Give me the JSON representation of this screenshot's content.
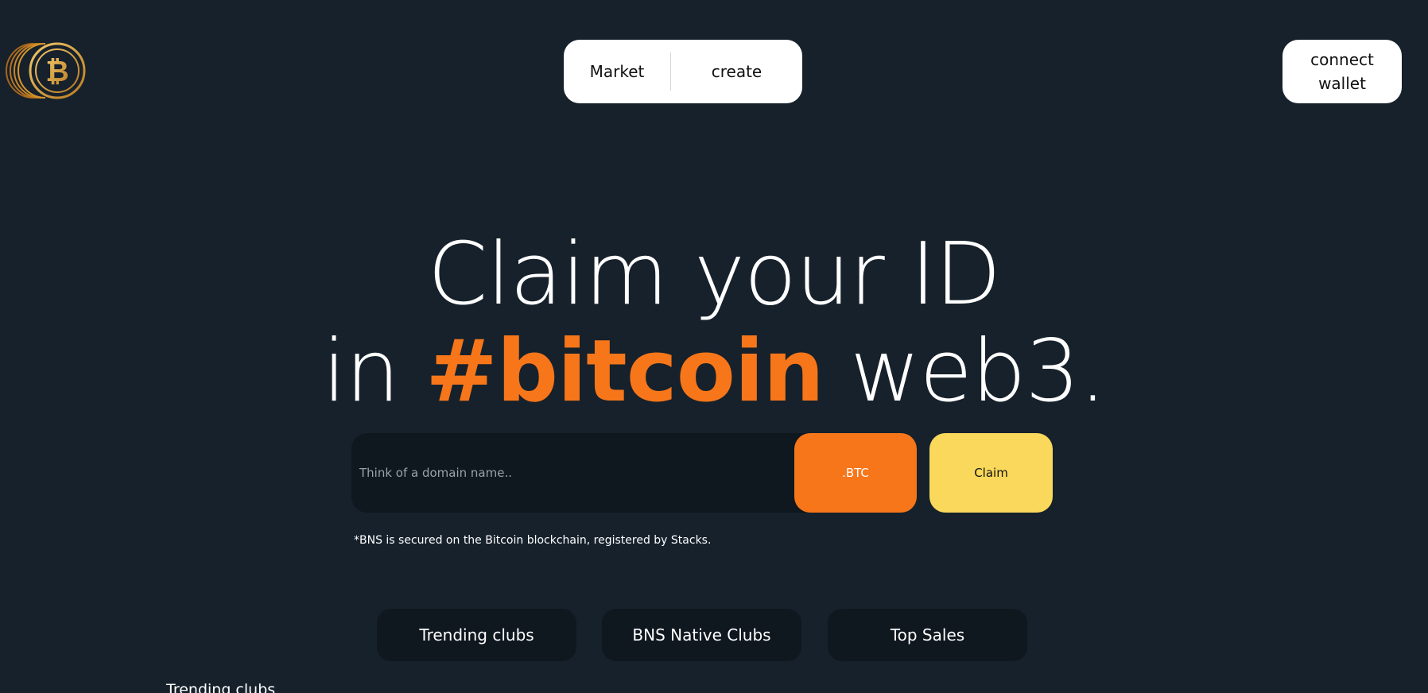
{
  "header": {
    "logo_icon": "bitcoin-coin-logo-icon",
    "nav": {
      "market_label": "Market",
      "create_label": "create"
    },
    "connect_wallet_label": "connect wallet"
  },
  "hero": {
    "line1": "Claim your ID",
    "line2_prefix": "in ",
    "line2_accent": "#bitcoin",
    "line2_suffix": " web3."
  },
  "search": {
    "placeholder": "Think of a domain name..",
    "value": "",
    "tld_label": ".BTC",
    "claim_label": "Claim",
    "disclaimer": "*BNS is secured on the Bitcoin blockchain, registered by Stacks."
  },
  "tabs": [
    {
      "label": "Trending clubs"
    },
    {
      "label": "BNS Native Clubs"
    },
    {
      "label": "Top Sales"
    }
  ],
  "section_heading": "Trending clubs",
  "colors": {
    "background": "#16212b",
    "accent_orange": "#f7761a",
    "claim_yellow": "#f9d85b",
    "panel_dark": "#0f171f",
    "logo_gold": "#d9a441"
  }
}
